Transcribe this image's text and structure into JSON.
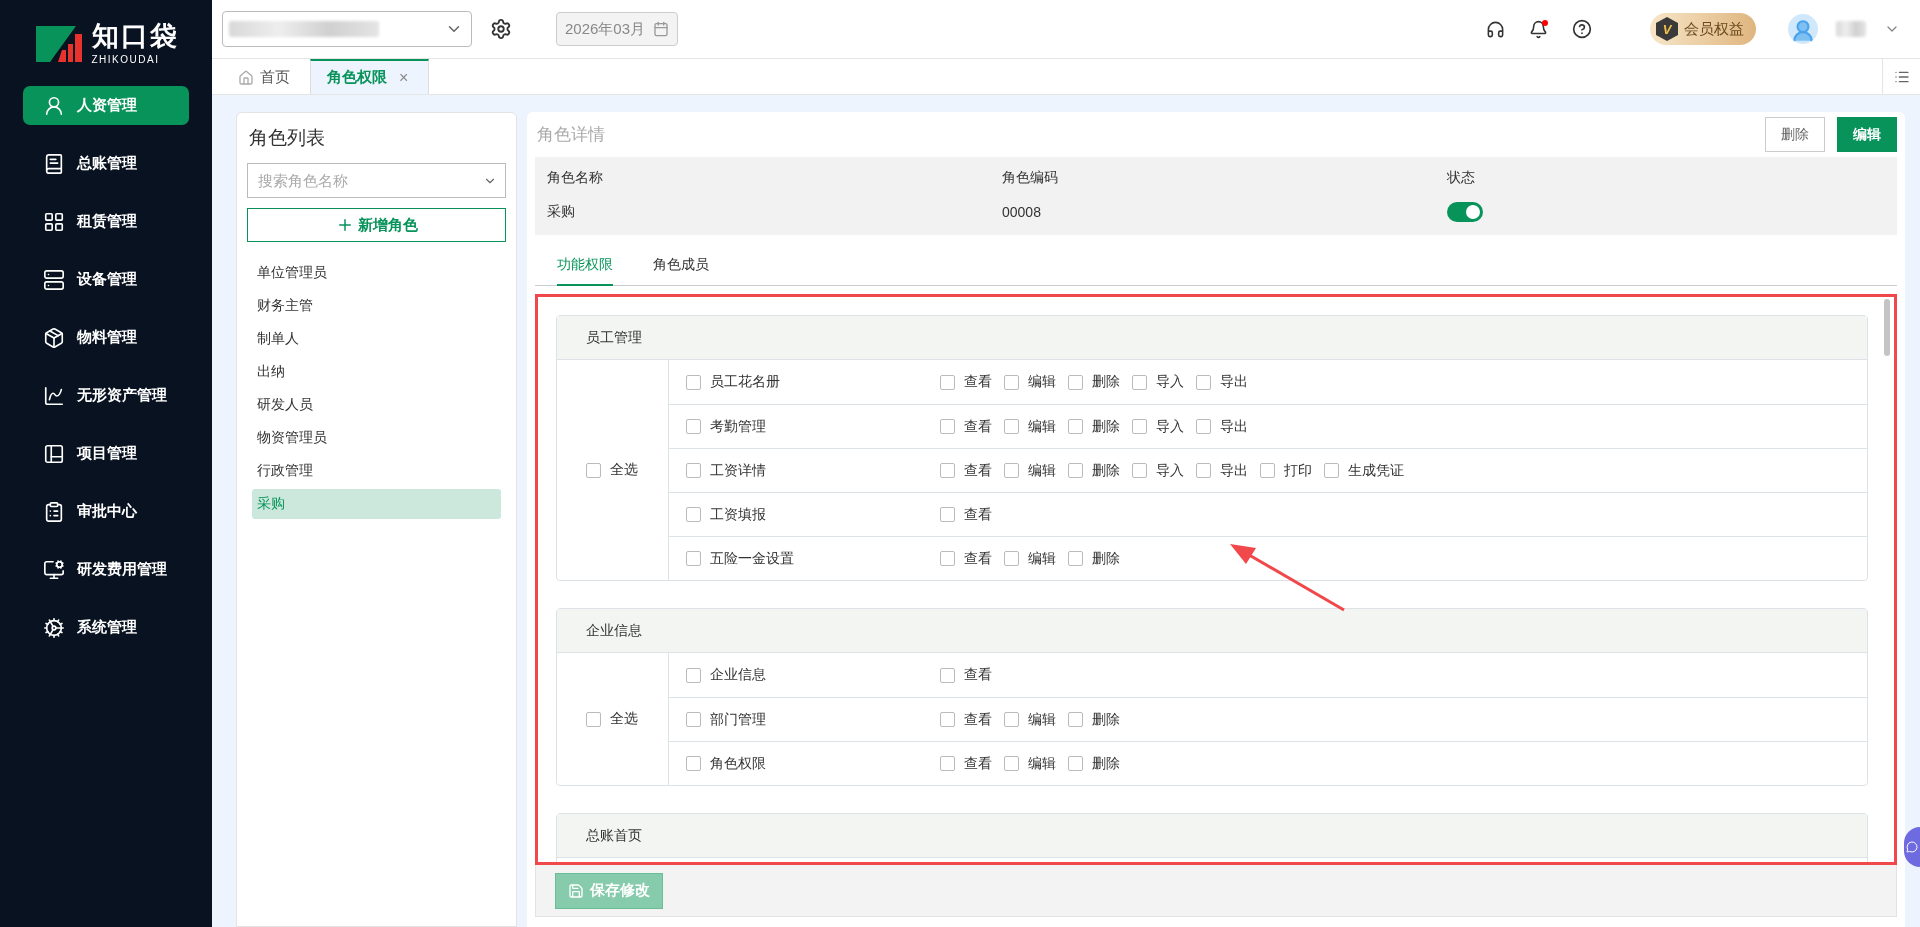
{
  "logo": {
    "name": "知口袋",
    "subtitle": "ZHIKOUDAI"
  },
  "sidebar": {
    "items": [
      {
        "label": "人资管理",
        "selected": true
      },
      {
        "label": "总账管理",
        "selected": false
      },
      {
        "label": "租赁管理",
        "selected": false
      },
      {
        "label": "设备管理",
        "selected": false
      },
      {
        "label": "物料管理",
        "selected": false
      },
      {
        "label": "无形资产管理",
        "selected": false
      },
      {
        "label": "项目管理",
        "selected": false
      },
      {
        "label": "审批中心",
        "selected": false
      },
      {
        "label": "研发费用管理",
        "selected": false
      },
      {
        "label": "系统管理",
        "selected": false
      }
    ]
  },
  "topbar": {
    "period": "2026年03月",
    "notification_dot": true,
    "vip_label": "会员权益",
    "vip_badge": "V"
  },
  "tabs": [
    {
      "label": "首页",
      "selected": false,
      "closable": false
    },
    {
      "label": "角色权限",
      "selected": true,
      "closable": true
    }
  ],
  "tab_close": "×",
  "role_list": {
    "title": "角色列表",
    "search": {
      "placeholder": "搜索角色名称"
    },
    "add_button": "新增角色",
    "roles": [
      {
        "label": "单位管理员",
        "selected": false
      },
      {
        "label": "财务主管",
        "selected": false
      },
      {
        "label": "制单人",
        "selected": false
      },
      {
        "label": "出纳",
        "selected": false
      },
      {
        "label": "研发人员",
        "selected": false
      },
      {
        "label": "物资管理员",
        "selected": false
      },
      {
        "label": "行政管理",
        "selected": false
      },
      {
        "label": "采购",
        "selected": true
      }
    ]
  },
  "detail": {
    "title": "角色详情",
    "buttons": [
      {
        "label": "删除",
        "kind": "plain"
      },
      {
        "label": "编辑",
        "kind": "primary"
      }
    ],
    "fields": [
      {
        "label": "角色名称",
        "value": "采购",
        "kind": "text"
      },
      {
        "label": "角色编码",
        "value": "00008",
        "kind": "text"
      },
      {
        "label": "状态",
        "on": true,
        "kind": "switch"
      }
    ],
    "tabs": [
      {
        "label": "功能权限",
        "selected": true
      },
      {
        "label": "角色成员",
        "selected": false
      }
    ]
  },
  "groups": [
    {
      "title": "员工管理",
      "select_all": {
        "label": "全选",
        "checked": false
      },
      "rows": [
        {
          "module": {
            "label": "员工花名册",
            "checked": false
          },
          "actions": [
            {
              "label": "查看",
              "checked": false
            },
            {
              "label": "编辑",
              "checked": false
            },
            {
              "label": "删除",
              "checked": false
            },
            {
              "label": "导入",
              "checked": false
            },
            {
              "label": "导出",
              "checked": false
            }
          ]
        },
        {
          "module": {
            "label": "考勤管理",
            "checked": false
          },
          "actions": [
            {
              "label": "查看",
              "checked": false
            },
            {
              "label": "编辑",
              "checked": false
            },
            {
              "label": "删除",
              "checked": false
            },
            {
              "label": "导入",
              "checked": false
            },
            {
              "label": "导出",
              "checked": false
            }
          ]
        },
        {
          "module": {
            "label": "工资详情",
            "checked": false
          },
          "actions": [
            {
              "label": "查看",
              "checked": false
            },
            {
              "label": "编辑",
              "checked": false
            },
            {
              "label": "删除",
              "checked": false
            },
            {
              "label": "导入",
              "checked": false
            },
            {
              "label": "导出",
              "checked": false
            },
            {
              "label": "打印",
              "checked": false
            },
            {
              "label": "生成凭证",
              "checked": false
            }
          ]
        },
        {
          "module": {
            "label": "工资填报",
            "checked": false
          },
          "actions": [
            {
              "label": "查看",
              "checked": false
            }
          ]
        },
        {
          "module": {
            "label": "五险一金设置",
            "checked": false
          },
          "actions": [
            {
              "label": "查看",
              "checked": false
            },
            {
              "label": "编辑",
              "checked": false
            },
            {
              "label": "删除",
              "checked": false
            }
          ]
        }
      ]
    },
    {
      "title": "企业信息",
      "select_all": {
        "label": "全选",
        "checked": false
      },
      "rows": [
        {
          "module": {
            "label": "企业信息",
            "checked": false
          },
          "actions": [
            {
              "label": "查看",
              "checked": false
            }
          ]
        },
        {
          "module": {
            "label": "部门管理",
            "checked": false
          },
          "actions": [
            {
              "label": "查看",
              "checked": false
            },
            {
              "label": "编辑",
              "checked": false
            },
            {
              "label": "删除",
              "checked": false
            }
          ]
        },
        {
          "module": {
            "label": "角色权限",
            "checked": false
          },
          "actions": [
            {
              "label": "查看",
              "checked": false
            },
            {
              "label": "编辑",
              "checked": false
            },
            {
              "label": "删除",
              "checked": false
            }
          ]
        }
      ]
    },
    {
      "title": "总账首页"
    }
  ],
  "save_button": {
    "label": "保存修改",
    "disabled": true
  }
}
